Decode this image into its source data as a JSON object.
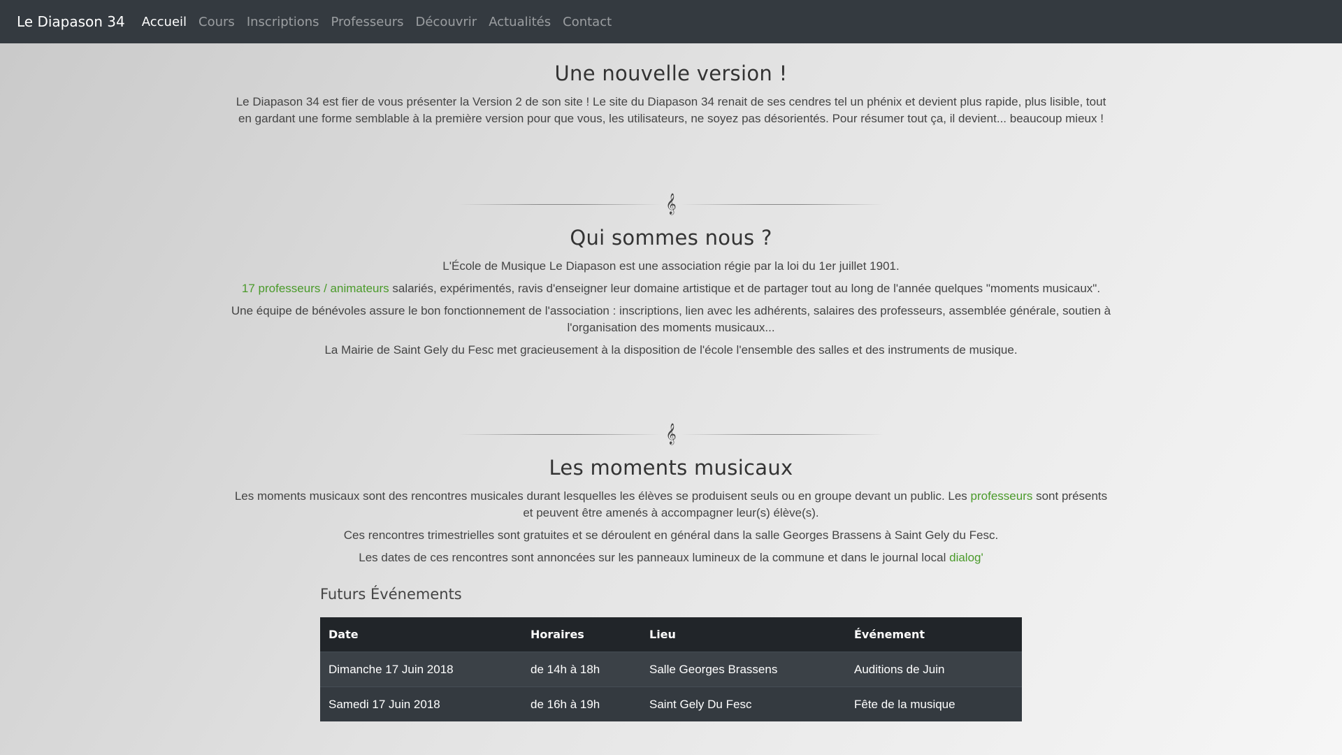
{
  "nav": {
    "brand": "Le Diapason 34",
    "items": [
      {
        "label": "Accueil",
        "active": true
      },
      {
        "label": "Cours"
      },
      {
        "label": "Inscriptions"
      },
      {
        "label": "Professeurs"
      },
      {
        "label": "Découvrir"
      },
      {
        "label": "Actualités"
      },
      {
        "label": "Contact"
      }
    ]
  },
  "section1": {
    "title": "Une nouvelle version !",
    "p1": "Le Diapason 34 est fier de vous présenter la Version 2 de son site ! Le site du Diapason 34 renait de ses cendres tel un phénix et devient plus rapide, plus lisible, tout en gardant une forme semblable à la première version pour que vous, les utilisateurs, ne soyez pas désorientés. Pour résumer tout ça, il devient... beaucoup mieux !"
  },
  "divider_icon": "𝄞",
  "section2": {
    "title": "Qui sommes nous ?",
    "p1": "L'École de Musique Le Diapason est une association régie par la loi du 1er juillet 1901.",
    "p2_link": "17 professeurs / animateurs",
    "p2_rest": " salariés, expérimentés, ravis d'enseigner leur domaine artistique et de partager tout au long de l'année quelques \"moments musicaux\".",
    "p3": "Une équipe de bénévoles assure le bon fonctionnement de l'association : inscriptions, lien avec les adhérents, salaires des professeurs, assemblée générale, soutien à l'organisation des moments musicaux...",
    "p4": "La Mairie de Saint Gely du Fesc met gracieusement à la disposition de l'école l'ensemble des salles et des instruments de musique."
  },
  "section3": {
    "title": "Les moments musicaux",
    "p1_start": "Les moments musicaux sont des rencontres musicales durant lesquelles les élèves se produisent seuls ou en groupe devant un public. Les ",
    "p1_link": "professeurs",
    "p1_end": " sont présents et peuvent être amenés à accompagner leur(s) élève(s).",
    "p2": "Ces rencontres trimestrielles sont gratuites et se déroulent en général dans la salle Georges Brassens à Saint Gely du Fesc.",
    "p3_start": "Les dates de ces rencontres sont annoncées sur les panneaux lumineux de la commune et dans le journal local ",
    "p3_link": "dialog'"
  },
  "events": {
    "title": "Futurs Événements",
    "headers": [
      "Date",
      "Horaires",
      "Lieu",
      "Événement"
    ],
    "rows": [
      [
        "Dimanche 17 Juin 2018",
        "de 14h à 18h",
        "Salle Georges Brassens",
        "Auditions de Juin"
      ],
      [
        "Samedi 17 Juin 2018",
        "de 16h à 19h",
        "Saint Gely Du Fesc",
        "Fête de la musique"
      ]
    ]
  },
  "colors": {
    "navbar": "#343a40",
    "link_green": "#4a9a2a"
  }
}
